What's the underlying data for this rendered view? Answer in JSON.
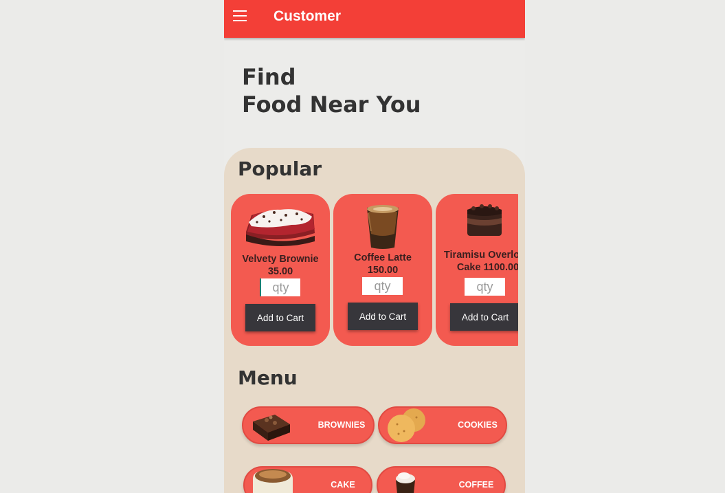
{
  "appbar": {
    "title": "Customer",
    "menu_icon": "hamburger-menu-icon"
  },
  "hero": {
    "line1": "Find",
    "line2": "Food Near You"
  },
  "popular": {
    "title": "Popular",
    "items": [
      {
        "name": "Velvety Brownie",
        "price": "35.00",
        "qty_placeholder": "qty",
        "button": "Add to Cart"
      },
      {
        "name": "Coffee Latte",
        "price": "150.00",
        "qty_placeholder": "qty",
        "button": "Add to Cart"
      },
      {
        "name": "Tiramisu Overlo",
        "price": "Cake 1100.00",
        "qty_placeholder": "qty",
        "button": "Add to Cart"
      }
    ]
  },
  "menu": {
    "title": "Menu",
    "categories": [
      {
        "label": "BROWNIES"
      },
      {
        "label": "COOKIES"
      },
      {
        "label": "CAKE"
      },
      {
        "label": "COFFEE"
      }
    ]
  },
  "colors": {
    "appbar": "#f33f37",
    "card": "#f35a50",
    "panel": "#e7dac9",
    "button": "#37363b"
  }
}
